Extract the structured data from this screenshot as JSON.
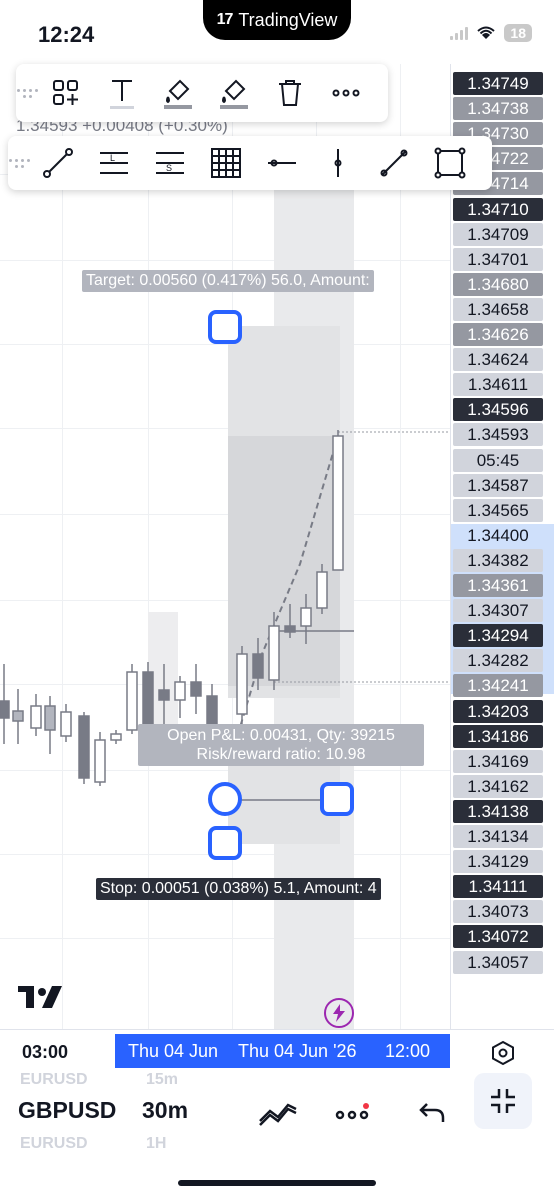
{
  "status_bar": {
    "time": "12:24",
    "island_text": "TradingView",
    "battery": "18"
  },
  "legend": {
    "text": "1.34593 +0.00408 (+0.30%)"
  },
  "toolbar_top": {
    "tools": [
      "add-object-icon",
      "text-icon",
      "fill-color-icon",
      "line-color-icon",
      "trash-icon",
      "more-icon"
    ]
  },
  "toolbar_drawing": {
    "tools": [
      "trend-line-icon",
      "long-position-icon",
      "short-position-icon",
      "grid-icon",
      "horizontal-ray-icon",
      "vertical-line-icon",
      "ray-icon",
      "rectangle-icon"
    ]
  },
  "price_scale": {
    "labels": [
      {
        "text": "1.34749",
        "style": "dark"
      },
      {
        "text": "1.34738",
        "style": "mid"
      },
      {
        "text": "1.34730",
        "style": "mid"
      },
      {
        "text": "1.34722",
        "style": "mid"
      },
      {
        "text": "1.34714",
        "style": "mid"
      },
      {
        "text": "1.34710",
        "style": "dark"
      },
      {
        "text": "1.34709",
        "style": "light"
      },
      {
        "text": "1.34701",
        "style": "light"
      },
      {
        "text": "1.34680",
        "style": "mid"
      },
      {
        "text": "1.34658",
        "style": "light"
      },
      {
        "text": "1.34626",
        "style": "mid"
      },
      {
        "text": "1.34624",
        "style": "light"
      },
      {
        "text": "1.34611",
        "style": "light"
      },
      {
        "text": "1.34596",
        "style": "dark"
      },
      {
        "text": "1.34593",
        "style": "light"
      },
      {
        "text": "05:45",
        "style": "light"
      },
      {
        "text": "1.34587",
        "style": "light"
      },
      {
        "text": "1.34565",
        "style": "light"
      },
      {
        "text": "1.34400",
        "style": "plain"
      },
      {
        "text": "1.34382",
        "style": "light"
      },
      {
        "text": "1.34361",
        "style": "mid"
      },
      {
        "text": "1.34307",
        "style": "light"
      },
      {
        "text": "1.34294",
        "style": "dark"
      },
      {
        "text": "1.34282",
        "style": "light"
      },
      {
        "text": "1.34241",
        "style": "mid"
      },
      {
        "text": "1.34203",
        "style": "dark"
      },
      {
        "text": "1.34186",
        "style": "dark"
      },
      {
        "text": "1.34169",
        "style": "light"
      },
      {
        "text": "1.34162",
        "style": "light"
      },
      {
        "text": "1.34138",
        "style": "dark"
      },
      {
        "text": "1.34134",
        "style": "light"
      },
      {
        "text": "1.34129",
        "style": "light"
      },
      {
        "text": "1.34111",
        "style": "dark"
      },
      {
        "text": "1.34073",
        "style": "light"
      },
      {
        "text": "1.34072",
        "style": "dark"
      },
      {
        "text": "1.34057",
        "style": "light"
      }
    ]
  },
  "position_tool": {
    "target_label": "Target: 0.00560 (0.417%) 56.0, Amount:",
    "pnl_label": "Open P&L: 0.00431, Qty: 39215",
    "rr_label": "Risk/reward ratio: 10.98",
    "stop_label": "Stop: 0.00051 (0.038%) 5.1, Amount: 4"
  },
  "time_scale": {
    "left_time": "03:00",
    "sel_a": "Thu 04 Jun",
    "sel_b": "Thu 04 Jun '26",
    "sel_c": "12:00"
  },
  "bottom_bar": {
    "symbol": "GBPUSD",
    "interval": "30m",
    "ghost_above_symbol": "EURUSD",
    "ghost_above_interval": "15m",
    "ghost_below_symbol": "EURUSD",
    "ghost_below_interval": "1H"
  },
  "colors": {
    "accent": "#2962ff",
    "dark_label": "#2a2e39",
    "candle": "#b2b5be"
  }
}
